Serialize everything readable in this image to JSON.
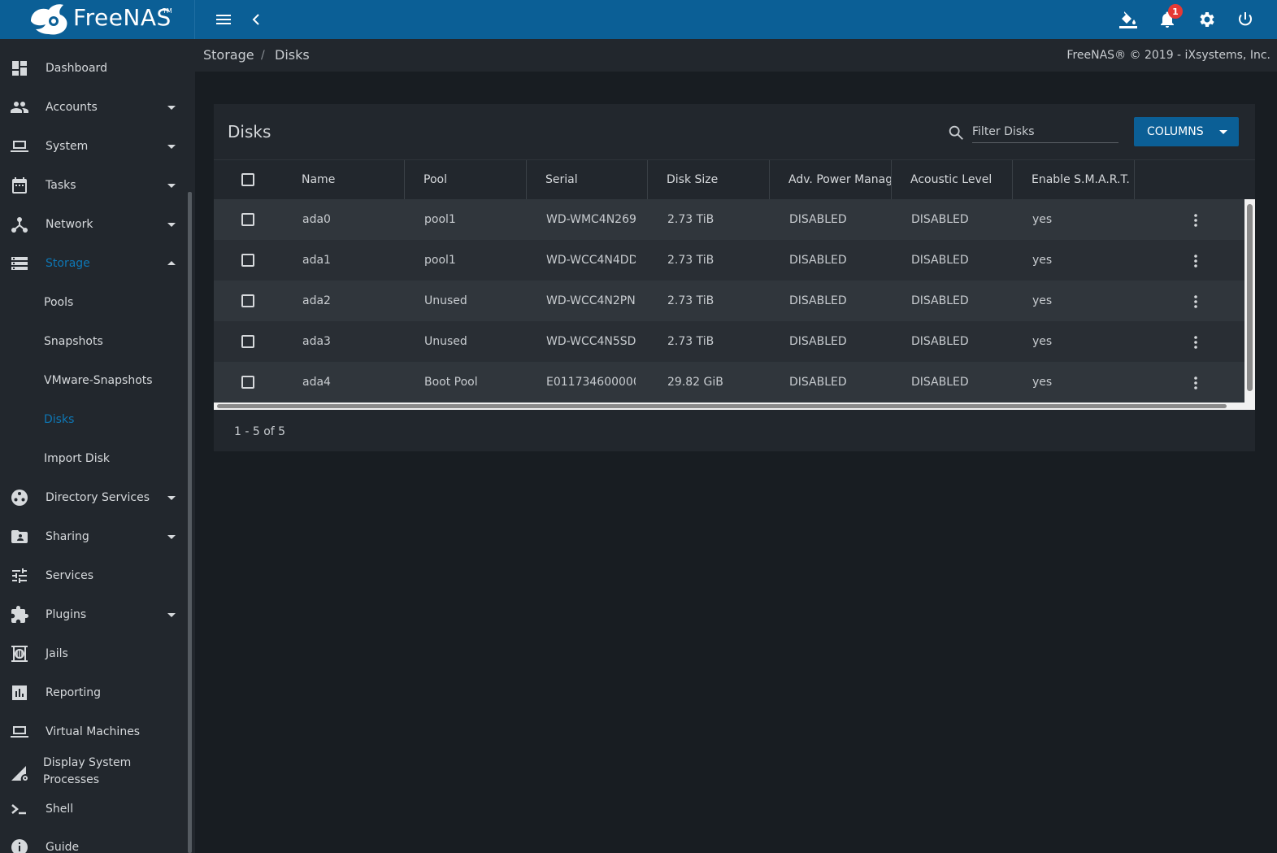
{
  "app": {
    "name": "FreeNAS",
    "notification_count": "1"
  },
  "breadcrumb": {
    "parent": "Storage",
    "sep": "/",
    "current": "Disks"
  },
  "copyright": "FreeNAS® © 2019 - iXsystems, Inc.",
  "sidebar": {
    "items": [
      {
        "label": "Dashboard"
      },
      {
        "label": "Accounts"
      },
      {
        "label": "System"
      },
      {
        "label": "Tasks"
      },
      {
        "label": "Network"
      },
      {
        "label": "Storage"
      },
      {
        "label": "Directory Services"
      },
      {
        "label": "Sharing"
      },
      {
        "label": "Services"
      },
      {
        "label": "Plugins"
      },
      {
        "label": "Jails"
      },
      {
        "label": "Reporting"
      },
      {
        "label": "Virtual Machines"
      },
      {
        "label": "Display System",
        "label2": "Processes"
      },
      {
        "label": "Shell"
      },
      {
        "label": "Guide"
      }
    ],
    "storage_sub": [
      {
        "label": "Pools"
      },
      {
        "label": "Snapshots"
      },
      {
        "label": "VMware-Snapshots"
      },
      {
        "label": "Disks"
      },
      {
        "label": "Import Disk"
      }
    ]
  },
  "card": {
    "title": "Disks",
    "filter_placeholder": "Filter Disks",
    "columns_label": "COLUMNS"
  },
  "table": {
    "headers": [
      "Name",
      "Pool",
      "Serial",
      "Disk Size",
      "Adv. Power Manag",
      "Acoustic Level",
      "Enable S.M.A.R.T."
    ],
    "rows": [
      [
        "ada0",
        "pool1",
        "WD-WMC4N269",
        "2.73 TiB",
        "DISABLED",
        "DISABLED",
        "yes"
      ],
      [
        "ada1",
        "pool1",
        "WD-WCC4N4DD",
        "2.73 TiB",
        "DISABLED",
        "DISABLED",
        "yes"
      ],
      [
        "ada2",
        "Unused",
        "WD-WCC4N2PN",
        "2.73 TiB",
        "DISABLED",
        "DISABLED",
        "yes"
      ],
      [
        "ada3",
        "Unused",
        "WD-WCC4N5SD",
        "2.73 TiB",
        "DISABLED",
        "DISABLED",
        "yes"
      ],
      [
        "ada4",
        "Boot Pool",
        "E011734600000",
        "29.82 GiB",
        "DISABLED",
        "DISABLED",
        "yes"
      ]
    ],
    "paginator": "1 - 5 of 5"
  },
  "colors": {
    "topbar": "#0b5f96",
    "accent": "#0e77b5",
    "sidebar": "#22272d",
    "content": "#181d22"
  }
}
